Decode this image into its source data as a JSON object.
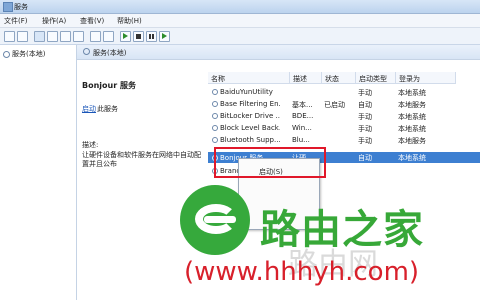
{
  "window": {
    "title": "服务"
  },
  "menubar": {
    "items": [
      "文件(F)",
      "操作(A)",
      "查看(V)",
      "帮助(H)"
    ]
  },
  "tree": {
    "item": "服务(本地)"
  },
  "header": {
    "title": "服务(本地)"
  },
  "detail": {
    "service_name": "Bonjour 服务",
    "start_link": "启动",
    "start_suffix": "此服务",
    "desc_label": "描述:",
    "desc_text": "让硬件设备和软件服务在网络中自动配置并且公布"
  },
  "columns": [
    "名称",
    "描述",
    "状态",
    "启动类型",
    "登录为"
  ],
  "rows": [
    {
      "name": "BaiduYunUtility",
      "desc": "",
      "status": "",
      "startup": "手动",
      "logon": "本地系统"
    },
    {
      "name": "Base Filtering En...",
      "desc": "基本...",
      "status": "已启动",
      "startup": "自动",
      "logon": "本地服务"
    },
    {
      "name": "BitLocker Drive ...",
      "desc": "BDE...",
      "status": "",
      "startup": "手动",
      "logon": "本地系统"
    },
    {
      "name": "Block Level Back...",
      "desc": "Win...",
      "status": "",
      "startup": "手动",
      "logon": "本地系统"
    },
    {
      "name": "Bluetooth Supp...",
      "desc": "Blu...",
      "status": "",
      "startup": "手动",
      "logon": "本地服务"
    },
    {
      "name": "Bonjour 服务",
      "desc": "让硬...",
      "status": "",
      "startup": "自动",
      "logon": "本地系统"
    },
    {
      "name": "BranchCach...",
      "desc": "",
      "status": "",
      "startup": "",
      "logon": ""
    }
  ],
  "context_menu": {
    "item": "启动(S)"
  },
  "watermark": {
    "cn": "路由之家",
    "url": "(www.hhhyh.com)",
    "faint": "路由网"
  },
  "colors": {
    "selected_row": "#3d7fd1",
    "highlight_border": "#e0182a",
    "watermark_green": "#37a838",
    "watermark_red": "#d8202b"
  }
}
